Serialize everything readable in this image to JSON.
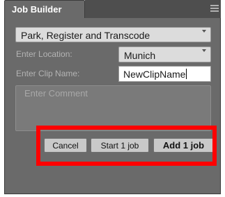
{
  "panel": {
    "title": "Job Builder",
    "menu_icon": "hamburger-menu-icon"
  },
  "form": {
    "workflow_select": {
      "value": "Park, Register and Transcode"
    },
    "location": {
      "label": "Enter Location:",
      "value": "Munich"
    },
    "clip_name": {
      "label": "Enter Clip Name:",
      "value": "NewClipName"
    },
    "comment": {
      "placeholder": "Enter Comment",
      "value": ""
    }
  },
  "buttons": {
    "cancel": "Cancel",
    "start": "Start 1 job",
    "add": "Add 1 job"
  },
  "colors": {
    "highlight": "#ff0000",
    "panel_bg": "#6a6a6a"
  }
}
